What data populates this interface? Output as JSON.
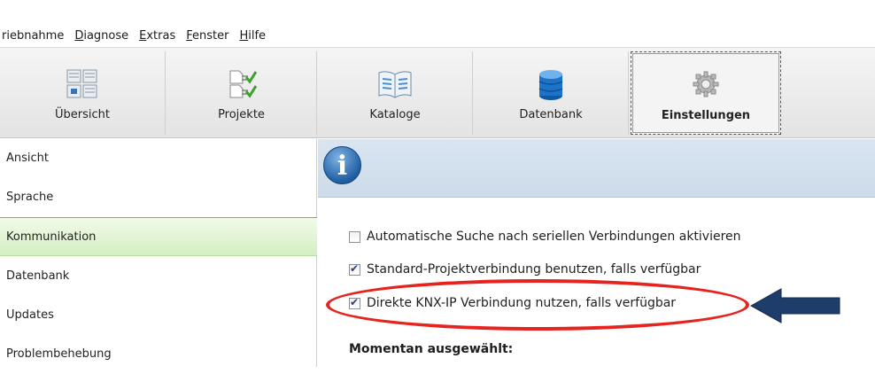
{
  "menu": [
    {
      "pre": "riebnahme",
      "u": "",
      "post": ""
    },
    {
      "pre": "",
      "u": "D",
      "post": "iagnose"
    },
    {
      "pre": "",
      "u": "E",
      "post": "xtras"
    },
    {
      "pre": "",
      "u": "F",
      "post": "enster"
    },
    {
      "pre": "",
      "u": "H",
      "post": "ilfe"
    }
  ],
  "toolbar": {
    "uebersicht": "Übersicht",
    "projekte": "Projekte",
    "kataloge": "Kataloge",
    "datenbank": "Datenbank",
    "einstellungen": "Einstellungen"
  },
  "sidebar": {
    "items": [
      "Ansicht",
      "Sprache",
      "Kommunikation",
      "Datenbank",
      "Updates",
      "Problembehebung"
    ],
    "selected": "Kommunikation"
  },
  "main": {
    "options": [
      {
        "label": "Automatische Suche nach seriellen Verbindungen aktivieren",
        "checked": false
      },
      {
        "label": "Standard-Projektverbindung benutzen, falls verfügbar",
        "checked": true
      },
      {
        "label": "Direkte KNX-IP Verbindung nutzen, falls verfügbar",
        "checked": true
      }
    ],
    "current_label": "Momentan ausgewählt:",
    "info_icon": "i"
  },
  "colors": {
    "selection_green": "#d4efc2",
    "annotation_red": "#e52420",
    "annotation_arrow": "#1f3d6b",
    "info_blue": "#1f5fa3"
  },
  "icons": {
    "uebersicht": "overview-grid-icon",
    "projekte": "projects-checklist-icon",
    "kataloge": "catalog-book-icon",
    "datenbank": "database-cylinder-icon",
    "einstellungen": "settings-gear-icon"
  }
}
